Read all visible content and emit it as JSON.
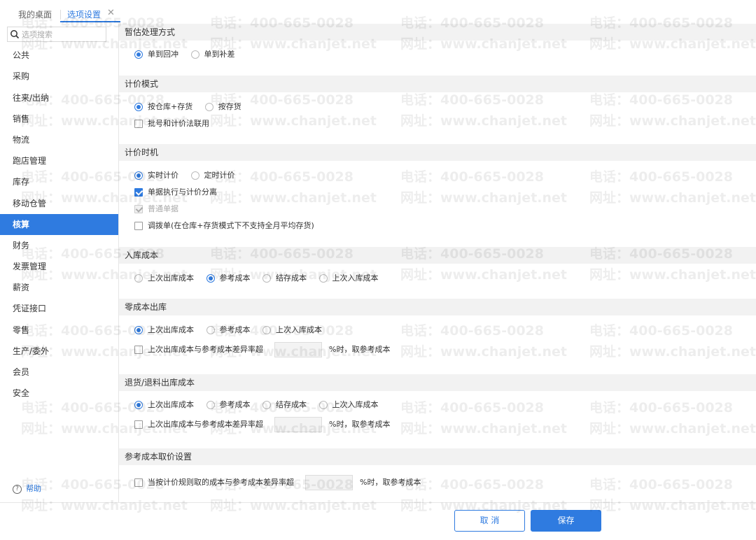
{
  "tabs": [
    {
      "label": "我的桌面"
    },
    {
      "label": "选项设置"
    }
  ],
  "sidebar": {
    "search_placeholder": "选项搜索",
    "items": [
      {
        "label": "公共"
      },
      {
        "label": "采购"
      },
      {
        "label": "往来/出纳"
      },
      {
        "label": "销售"
      },
      {
        "label": "物流"
      },
      {
        "label": "跑店管理"
      },
      {
        "label": "库存"
      },
      {
        "label": "移动仓管"
      },
      {
        "label": "核算"
      },
      {
        "label": "财务"
      },
      {
        "label": "发票管理"
      },
      {
        "label": "薪资"
      },
      {
        "label": "凭证接口"
      },
      {
        "label": "零售"
      },
      {
        "label": "生产/委外"
      },
      {
        "label": "会员"
      },
      {
        "label": "安全"
      }
    ],
    "active": "核算",
    "help_label": "帮助"
  },
  "sections": {
    "s1": {
      "title": "暂估处理方式",
      "opt1": "单到回冲",
      "opt2": "单到补差"
    },
    "s2": {
      "title": "计价模式",
      "opt1": "按仓库+存货",
      "opt2": "按存货",
      "cb1": "批号和计价法联用"
    },
    "s3": {
      "title": "计价时机",
      "opt1": "实时计价",
      "opt2": "定时计价",
      "cb1": "单据执行与计价分离",
      "cb2": "普通单据",
      "cb3": "调拨单(在仓库+存货模式下不支持全月平均存货)"
    },
    "s4": {
      "title": "入库成本",
      "opt1": "上次出库成本",
      "opt2": "参考成本",
      "opt3": "结存成本",
      "opt4": "上次入库成本"
    },
    "s5": {
      "title": "零成本出库",
      "opt1": "上次出库成本",
      "opt2": "参考成本",
      "opt3": "上次入库成本",
      "cb1": "上次出库成本与参考成本差异率超",
      "suffix": "%时，取参考成本"
    },
    "s6": {
      "title": "退货/退料出库成本",
      "opt1": "上次出库成本",
      "opt2": "参考成本",
      "opt3": "结存成本",
      "opt4": "上次入库成本",
      "cb1": "上次出库成本与参考成本差异率超",
      "suffix": "%时，取参考成本"
    },
    "s7": {
      "title": "参考成本取价设置",
      "cb1": "当按计价规则取的成本与参考成本差异率超",
      "suffix": "%时，取参考成本"
    }
  },
  "footer": {
    "cancel_label": "取 消",
    "save_label": "保存"
  },
  "watermark": {
    "phone": "电话：400-665-0028",
    "site": "网址：www.chanjet.net"
  },
  "colors": {
    "accent": "#2f7be0"
  }
}
